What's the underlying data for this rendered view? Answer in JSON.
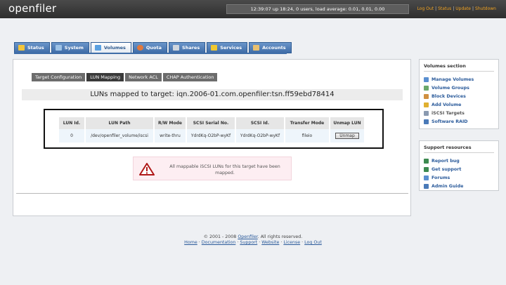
{
  "header": {
    "logo": "openfiler",
    "status": "12:39:07 up 18:24, 0 users, load average: 0.01, 0.01, 0.00",
    "links": [
      "Log Out",
      "Status",
      "Update",
      "Shutdown"
    ]
  },
  "tabs": [
    {
      "label": "Status",
      "color": "#f3c53a"
    },
    {
      "label": "System",
      "color": "#9ec3e6"
    },
    {
      "label": "Volumes",
      "color": "#5aa0e0"
    },
    {
      "label": "Quota",
      "color": "#e0783c"
    },
    {
      "label": "Shares",
      "color": "#cfd6de"
    },
    {
      "label": "Services",
      "color": "#f0c830"
    },
    {
      "label": "Accounts",
      "color": "#e8c070"
    }
  ],
  "subtabs": [
    "Target Configuration",
    "LUN Mapping",
    "Network ACL",
    "CHAP Authentication"
  ],
  "heading": "LUNs mapped to target: iqn.2006-01.com.openfiler:tsn.ff59ebd78414",
  "table": {
    "headers": [
      "LUN Id.",
      "LUN Path",
      "R/W Mode",
      "SCSI Serial No.",
      "SCSI Id.",
      "Transfer Mode",
      "Unmap LUN"
    ],
    "row": [
      "0",
      "/dev/openfiler_volume/iscsi",
      "write-thru",
      "YdrdKq-O2bP-wyKf",
      "YdrdKq-O2bP-wyKf",
      "fileio"
    ],
    "button": "Unmap"
  },
  "warning": "All mappable iSCSI LUNs for this target have been mapped.",
  "sidebar1": {
    "title": "Volumes section",
    "items": [
      "Manage Volumes",
      "Volume Groups",
      "Block Devices",
      "Add Volume",
      "iSCSI Targets",
      "Software RAID"
    ]
  },
  "sidebar2": {
    "title": "Support resources",
    "items": [
      "Report bug",
      "Get support",
      "Forums",
      "Admin Guide"
    ]
  },
  "footer": {
    "copyright_prefix": "© 2001 - 2008 ",
    "copyright_link": "Openfiler",
    "copyright_suffix": ". All rights reserved.",
    "links": [
      "Home",
      "Documentation",
      "Support",
      "Website",
      "License",
      "Log Out"
    ]
  }
}
